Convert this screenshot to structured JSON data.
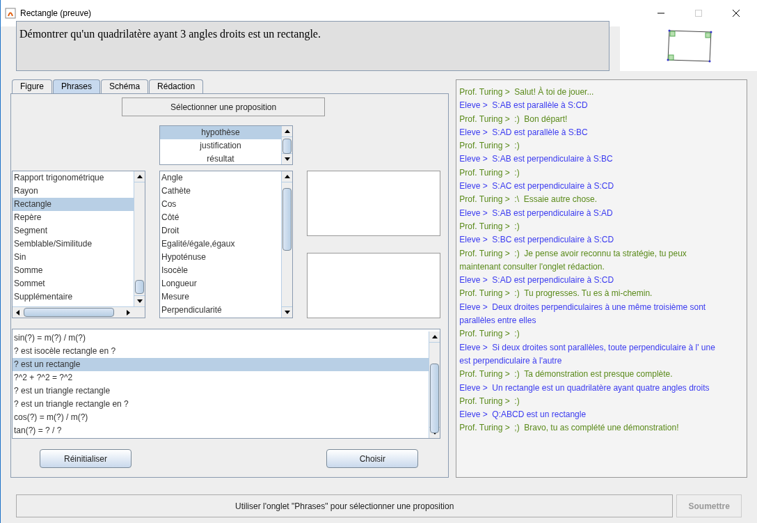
{
  "window": {
    "title": "Rectangle (preuve)"
  },
  "problem": "Démontrer qu'un quadrilatère ayant 3 angles droits est un rectangle.",
  "tabs": [
    {
      "label": "Figure",
      "selected": false
    },
    {
      "label": "Phrases",
      "selected": true
    },
    {
      "label": "Schéma",
      "selected": false
    },
    {
      "label": "Rédaction",
      "selected": false
    }
  ],
  "select_button": "Sélectionner une proposition",
  "roles": [
    {
      "label": "hypothèse",
      "selected": true
    },
    {
      "label": "justification",
      "selected": false
    },
    {
      "label": "résultat",
      "selected": false
    }
  ],
  "concepts": [
    {
      "label": "Rapport trigonométrique",
      "selected": false
    },
    {
      "label": "Rayon",
      "selected": false
    },
    {
      "label": "Rectangle",
      "selected": true
    },
    {
      "label": "Repère",
      "selected": false
    },
    {
      "label": "Segment",
      "selected": false
    },
    {
      "label": "Semblable/Similitude",
      "selected": false
    },
    {
      "label": "Sin",
      "selected": false
    },
    {
      "label": "Somme",
      "selected": false
    },
    {
      "label": "Sommet",
      "selected": false
    },
    {
      "label": "Supplémentaire",
      "selected": false
    }
  ],
  "terms": [
    {
      "label": "Angle",
      "selected": false
    },
    {
      "label": "Cathète",
      "selected": false
    },
    {
      "label": "Cos",
      "selected": false
    },
    {
      "label": "Côté",
      "selected": false
    },
    {
      "label": "Droit",
      "selected": false
    },
    {
      "label": "Egalité/égale,égaux",
      "selected": false
    },
    {
      "label": "Hypoténuse",
      "selected": false
    },
    {
      "label": "Isocèle",
      "selected": false
    },
    {
      "label": "Longueur",
      "selected": false
    },
    {
      "label": "Mesure",
      "selected": false
    },
    {
      "label": "Perpendicularité",
      "selected": false
    }
  ],
  "sentences": [
    {
      "label": "sin(?) = m(?) / m(?)",
      "selected": false
    },
    {
      "label": "? est isocèle rectangle en ?",
      "selected": false
    },
    {
      "label": "? est un rectangle",
      "selected": true
    },
    {
      "label": "?^2 + ?^2 = ?^2",
      "selected": false
    },
    {
      "label": "? est un triangle rectangle",
      "selected": false
    },
    {
      "label": "? est un triangle rectangle en ?",
      "selected": false
    },
    {
      "label": "cos(?) = m(?) / m(?)",
      "selected": false
    },
    {
      "label": "tan(?) = ? / ?",
      "selected": false
    }
  ],
  "buttons": {
    "reset": "Réinitialiser",
    "choose": "Choisir"
  },
  "chat": [
    {
      "kind": "prof",
      "text": "Prof. Turing >  Salut! À toi de jouer..."
    },
    {
      "kind": "eleve",
      "text": "Eleve >  S:AB est parallèle à S:CD"
    },
    {
      "kind": "prof",
      "text": "Prof. Turing >  :)  Bon départ!"
    },
    {
      "kind": "eleve",
      "text": "Eleve >  S:AD est parallèle à S:BC"
    },
    {
      "kind": "prof",
      "text": "Prof. Turing >  :)"
    },
    {
      "kind": "eleve",
      "text": "Eleve >  S:AB est perpendiculaire à S:BC"
    },
    {
      "kind": "prof",
      "text": "Prof. Turing >  :)"
    },
    {
      "kind": "eleve",
      "text": "Eleve >  S:AC est perpendiculaire à S:CD"
    },
    {
      "kind": "prof",
      "text": "Prof. Turing >  :\\  Essaie autre chose."
    },
    {
      "kind": "eleve",
      "text": "Eleve >  S:AB est perpendiculaire à S:AD"
    },
    {
      "kind": "prof",
      "text": "Prof. Turing >  :)"
    },
    {
      "kind": "eleve",
      "text": "Eleve >  S:BC est perpendiculaire à S:CD"
    },
    {
      "kind": "prof",
      "text": "Prof. Turing >  :)  Je pense avoir reconnu ta stratégie, tu peux maintenant consulter l'onglet rédaction."
    },
    {
      "kind": "eleve",
      "text": "Eleve >  S:AD est perpendiculaire à S:CD"
    },
    {
      "kind": "prof",
      "text": "Prof. Turing >  :)  Tu progresses. Tu es à mi-chemin."
    },
    {
      "kind": "eleve",
      "text": "Eleve >  Deux droites perpendiculaires à une même troisième sont parallèles entre elles"
    },
    {
      "kind": "prof",
      "text": "Prof. Turing >  :)"
    },
    {
      "kind": "eleve",
      "text": "Eleve >  Si deux droites sont parallèles, toute perpendiculaire à l' une est perpendiculaire à l'autre"
    },
    {
      "kind": "prof",
      "text": "Prof. Turing >  :)  Ta démonstration est presque complète."
    },
    {
      "kind": "eleve",
      "text": "Eleve >  Un rectangle est un quadrilatère ayant quatre angles droits"
    },
    {
      "kind": "prof",
      "text": "Prof. Turing >  :)"
    },
    {
      "kind": "eleve",
      "text": "Eleve >  Q:ABCD est un rectangle"
    },
    {
      "kind": "prof",
      "text": "Prof. Turing >  ;)  Bravo, tu as complété une démonstration!"
    }
  ],
  "status": "Utiliser l'onglet \"Phrases\" pour sélectionner une proposition",
  "submit": {
    "label": "Soumettre",
    "disabled": true
  }
}
